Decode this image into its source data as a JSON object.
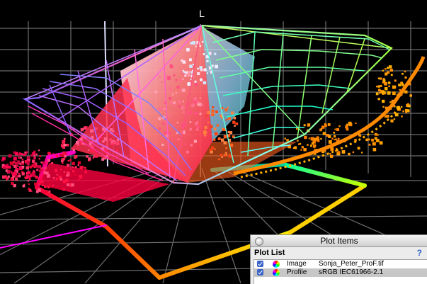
{
  "axis_label": "L",
  "colors": {
    "background": "#000000",
    "grid": "#6e6e6e",
    "panel_bg": "#ececec",
    "help": "#2f5fd0"
  },
  "panel": {
    "title": "Plot Items",
    "list_header": "Plot List",
    "help_label": "?",
    "items": [
      {
        "type": "Image",
        "name": "Sonja_Peter_ProF.tif",
        "checked": true,
        "icon": "color-wheel-icon"
      },
      {
        "type": "Profile",
        "name": "sRGB IEC61966-2.1",
        "checked": true,
        "icon": "color-wheel-icon"
      }
    ]
  }
}
